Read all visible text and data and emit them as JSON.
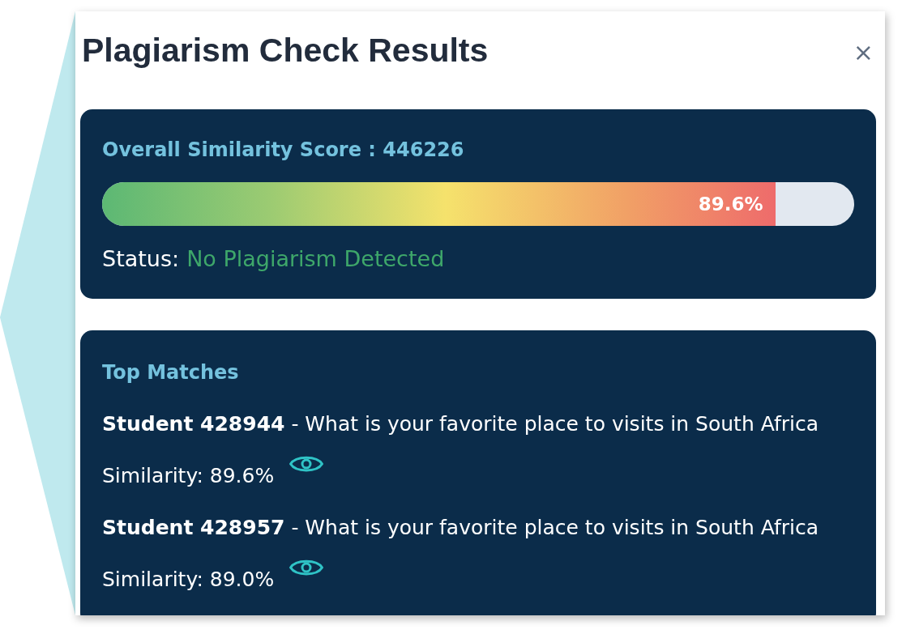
{
  "dialog": {
    "title": "Plagiarism Check Results",
    "close": "×"
  },
  "summary": {
    "heading": "Overall Similarity Score : 446226",
    "score": {
      "level": 0.896,
      "reading": "89.6%"
    },
    "status_label": "Status:",
    "status": "No Plagiarism Detected"
  },
  "top_matches": {
    "heading": "Top Matches",
    "items": [
      {
        "title": "**Student 428944** - What is your favorite place to visits in South Africa",
        "similarity": "Similarity: 89.6%"
      },
      {
        "title": "**Student 428957** - What is your favorite place to visits in South Africa",
        "similarity": "Similarity: 89.0%"
      }
    ]
  }
}
